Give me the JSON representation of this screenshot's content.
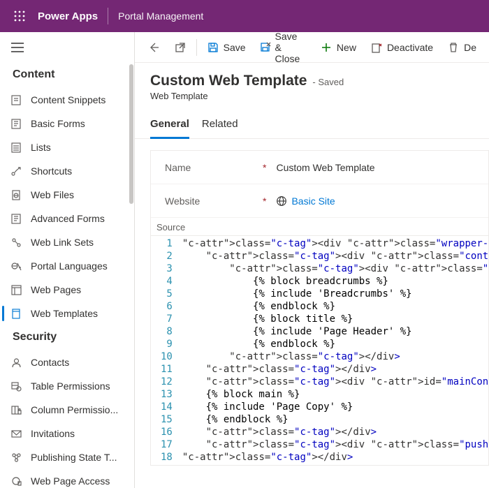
{
  "header": {
    "brand": "Power Apps",
    "app": "Portal Management"
  },
  "sidebar": {
    "sections": [
      {
        "title": "Content",
        "items": [
          {
            "label": "Content Snippets",
            "icon": "snippet"
          },
          {
            "label": "Basic Forms",
            "icon": "form"
          },
          {
            "label": "Lists",
            "icon": "list"
          },
          {
            "label": "Shortcuts",
            "icon": "shortcut"
          },
          {
            "label": "Web Files",
            "icon": "webfile"
          },
          {
            "label": "Advanced Forms",
            "icon": "form"
          },
          {
            "label": "Web Link Sets",
            "icon": "linkset"
          },
          {
            "label": "Portal Languages",
            "icon": "language"
          },
          {
            "label": "Web Pages",
            "icon": "webpage"
          },
          {
            "label": "Web Templates",
            "icon": "template",
            "active": true
          }
        ]
      },
      {
        "title": "Security",
        "items": [
          {
            "label": "Contacts",
            "icon": "contact"
          },
          {
            "label": "Table Permissions",
            "icon": "tableperm"
          },
          {
            "label": "Column Permissio...",
            "icon": "colperm"
          },
          {
            "label": "Invitations",
            "icon": "invite"
          },
          {
            "label": "Publishing State T...",
            "icon": "pubstate"
          },
          {
            "label": "Web Page Access",
            "icon": "webaccess"
          }
        ]
      }
    ]
  },
  "commandbar": {
    "back": "",
    "openNew": "",
    "save": "Save",
    "saveClose": "Save & Close",
    "new": "New",
    "deactivate": "Deactivate",
    "delete": "De"
  },
  "page": {
    "title": "Custom Web Template",
    "savedLabel": "- Saved",
    "entity": "Web Template"
  },
  "tabs": [
    "General",
    "Related"
  ],
  "activeTab": 0,
  "fields": {
    "nameLabel": "Name",
    "nameValue": "Custom Web Template",
    "websiteLabel": "Website",
    "websiteValue": "Basic Site",
    "sourceLabel": "Source"
  },
  "code": {
    "lines": [
      "<div class=\"wrapper-body\">",
      "    <div class=\"container\">",
      "        <div class=\"page-heading\">",
      "            {% block breadcrumbs %}",
      "            {% include 'Breadcrumbs' %}",
      "            {% endblock %}",
      "            {% block title %}",
      "            {% include 'Page Header' %}",
      "            {% endblock %}",
      "        </div>",
      "    </div>",
      "    <div id=\"mainContent\">",
      "    {% block main %}",
      "    {% include 'Page Copy' %}",
      "    {% endblock %}",
      "    </div>",
      "    <div class=\"push\"></div>",
      "</div>"
    ]
  }
}
